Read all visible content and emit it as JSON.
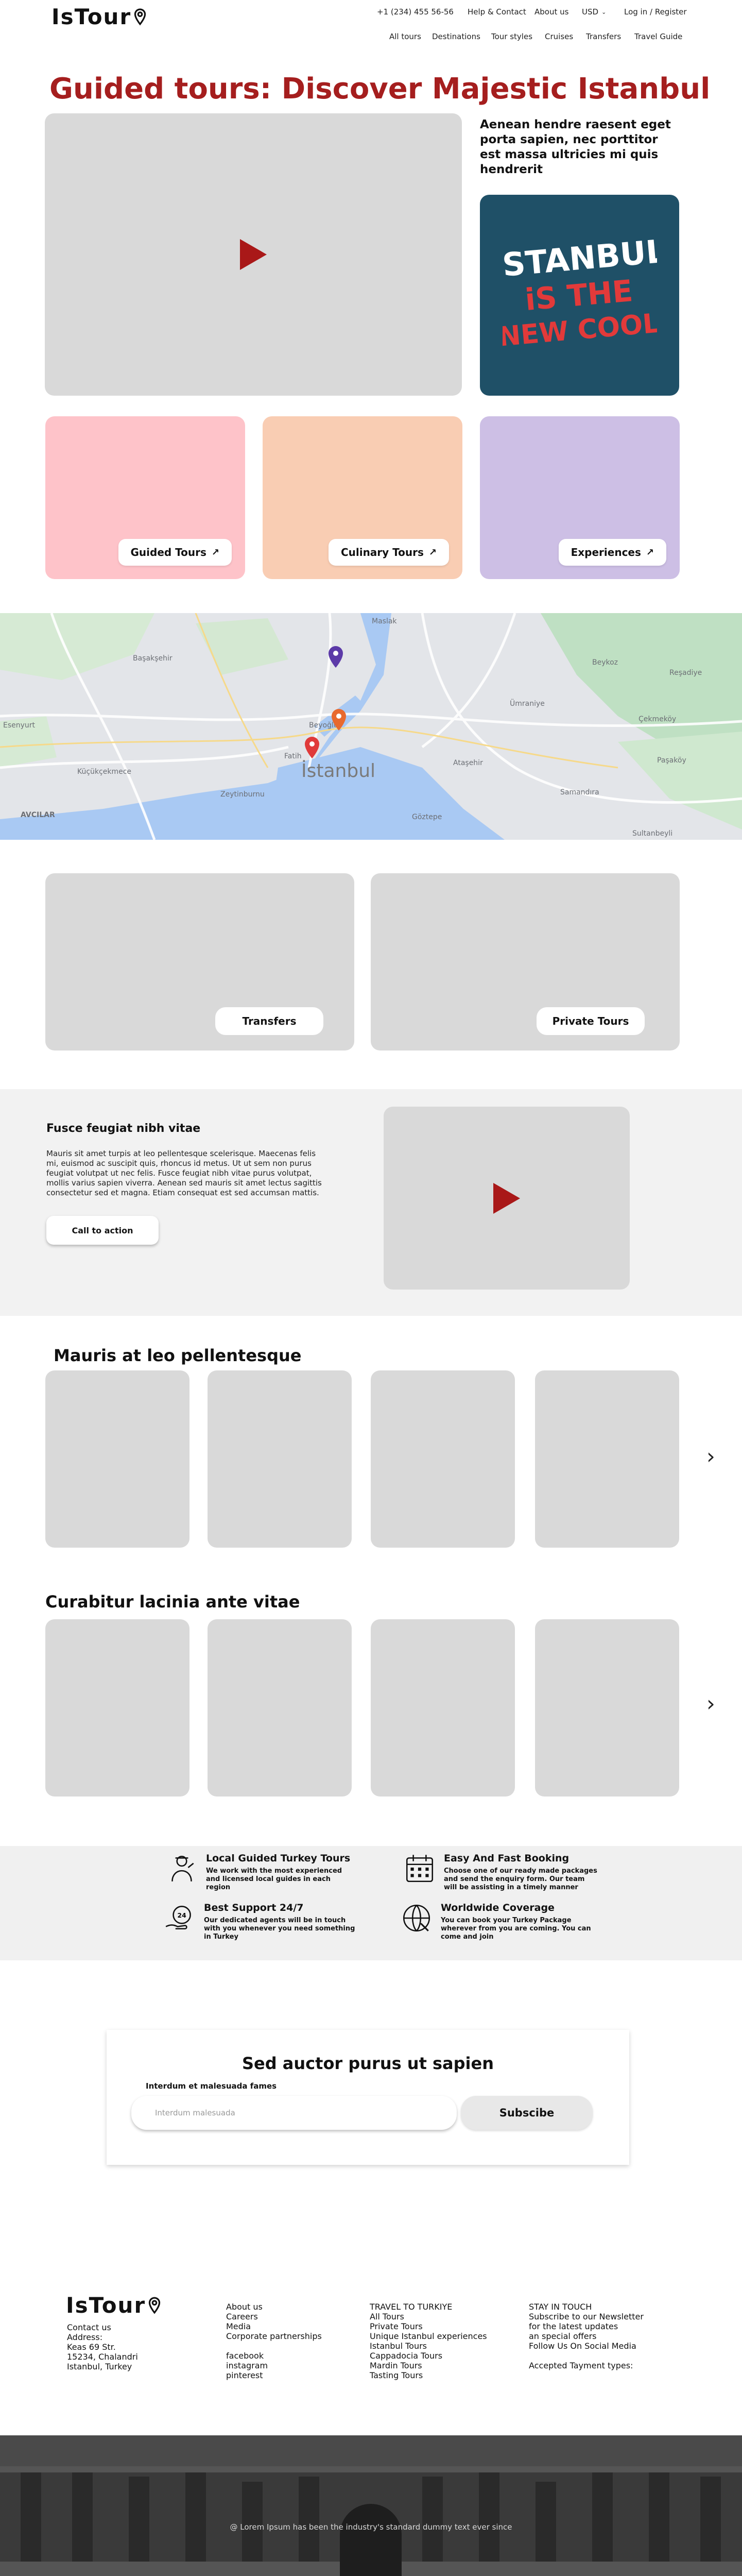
{
  "header": {
    "logo": "IsTour",
    "phone": "+1 (234) 455 56-56",
    "help": "Help & Contact",
    "about": "About us",
    "currency": "USD",
    "login": "Log in / Register",
    "nav": [
      "All tours",
      "Destinations",
      "Tour styles",
      "Cruises",
      "Transfers",
      "Travel Guide"
    ]
  },
  "hero": {
    "title": "Guided tours: Discover Majestic Istanbul",
    "lead": "Aenean hendre raesent eget porta sapien, nec porttitor est massa ultricies mi quis hendrerit",
    "istanbul_card": [
      "iSTANBUL",
      "iS THE",
      "NEW COOL"
    ]
  },
  "tiles": [
    {
      "label": "Guided Tours",
      "color": "#fec3c9"
    },
    {
      "label": "Culinary Tours",
      "color": "#f9cdb3"
    },
    {
      "label": "Experiences",
      "color": "#cdbfe5"
    }
  ],
  "map": {
    "city": "İstanbul",
    "labels": [
      "Maslak",
      "Başakşehir",
      "Esenyurt",
      "Küçükçekmece",
      "Zeytinburnu",
      "Fatih",
      "Beyoğlu",
      "Ataşehir",
      "Göztepe",
      "Samandıra",
      "Sultanbeyli",
      "Paşaköy",
      "Çekmeköy",
      "AVCILAR",
      "Ümraniye",
      "Beykoz",
      "Reşadiye"
    ],
    "pin_colors": [
      "#5c3aa8",
      "#e8692e",
      "#e03a3a"
    ]
  },
  "services": [
    {
      "label": "Transfers"
    },
    {
      "label": "Private Tours"
    }
  ],
  "feature": {
    "title": "Fusce feugiat nibh vitae",
    "body": "Mauris sit amet turpis at leo pellentesque scelerisque. Maecenas felis mi, euismod ac suscipit quis, rhoncus id metus. Ut ut sem non purus feugiat volutpat ut nec felis. Fusce feugiat nibh vitae purus volutpat, mollis varius sapien viverra. Aenean sed mauris sit amet lectus sagittis consectetur sed et magna. Etiam consequat est sed accumsan mattis.",
    "cta": "Call to action"
  },
  "carousel1": {
    "title": "Mauris at leo pellentesque"
  },
  "carousel2": {
    "title": "Curabitur lacinia ante vitae"
  },
  "benefits": [
    {
      "title": "Local Guided Turkey Tours",
      "desc": "We work with the most experienced and licensed local guides in each region",
      "icon": "guide-icon"
    },
    {
      "title": "Easy And Fast Booking",
      "desc": "Choose one of our ready made packages and send the enquiry form. Our team will be assisting in a timely manner",
      "icon": "calendar-icon"
    },
    {
      "title": "Best Support 24/7",
      "desc": "Our dedicated agents will be in touch with you whenever you need something in Turkey",
      "icon": "support-icon"
    },
    {
      "title": "Worldwide Coverage",
      "desc": "You can book your Turkey Package wherever from you are coming. You can come and join",
      "icon": "globe-icon"
    }
  ],
  "subscribe": {
    "title": "Sed auctor purus ut sapien",
    "label": "Interdum et malesuada fames",
    "placeholder": "Interdum malesuada",
    "button": "Subscibe"
  },
  "footer": {
    "logo": "IsTour",
    "col1": [
      "Contact us",
      "Address:",
      "Keas 69 Str.",
      "15234, Chalandri",
      "Istanbul, Turkey"
    ],
    "col2a": [
      "About us",
      "Careers",
      "Media",
      "Corporate partnerships"
    ],
    "col2b": [
      "facebook",
      "instagram",
      "pinterest"
    ],
    "col3": [
      "TRAVEL TO TURKIYE",
      "All Tours",
      "Private Tours",
      "Unique Istanbul experiences",
      "Istanbul Tours",
      "Cappadocia Tours",
      "Mardin Tours",
      "Tasting Tours"
    ],
    "col4a": [
      "STAY IN TOUCH",
      "Subscribe to our Newsletter",
      " for the latest updates",
      " an special offers",
      "Follow Us On Social Media"
    ],
    "col4b": "Accepted Tayment types:",
    "copyright": "@ Lorem Ipsum has been the industry's standard dummy text ever since"
  }
}
